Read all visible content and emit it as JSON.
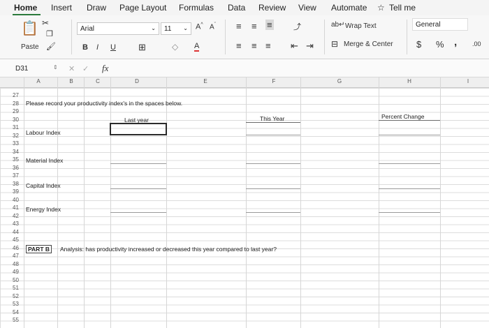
{
  "ribbon_tabs": [
    "Home",
    "Insert",
    "Draw",
    "Page Layout",
    "Formulas",
    "Data",
    "Review",
    "View",
    "Automate"
  ],
  "tell_me": "Tell me",
  "ribbon": {
    "paste_label": "Paste",
    "font_name": "Arial",
    "font_size": "11",
    "bold": "B",
    "italic": "I",
    "underline": "U",
    "wrap_text": "Wrap Text",
    "merge_center": "Merge & Center",
    "number_format": "General",
    "currency": "$",
    "percent": "%",
    "comma": ",",
    "decimal": ".00"
  },
  "formula_bar": {
    "name_box": "D31",
    "fx": "fx",
    "value": ""
  },
  "columns": [
    "A",
    "B",
    "C",
    "D",
    "E",
    "F",
    "G",
    "H",
    "I"
  ],
  "rows": [
    "27",
    "28",
    "29",
    "30",
    "31",
    "32",
    "33",
    "34",
    "35",
    "36",
    "37",
    "38",
    "39",
    "40",
    "41",
    "42",
    "43",
    "44",
    "45",
    "46",
    "47",
    "48",
    "49",
    "50",
    "51",
    "52",
    "53",
    "54",
    "55"
  ],
  "cells": {
    "r28": "Please record your productivity index's in the spaces below.",
    "last_year": "Last year",
    "this_year": "This Year",
    "percent_change": "Percent Change",
    "labour": "Labour Index",
    "material": "Material Index",
    "capital": "Capital Index",
    "energy": "Energy Index",
    "part_b": "PART B",
    "analysis": "Analysis: has productivity increased or decreased this year compared to last year?"
  }
}
